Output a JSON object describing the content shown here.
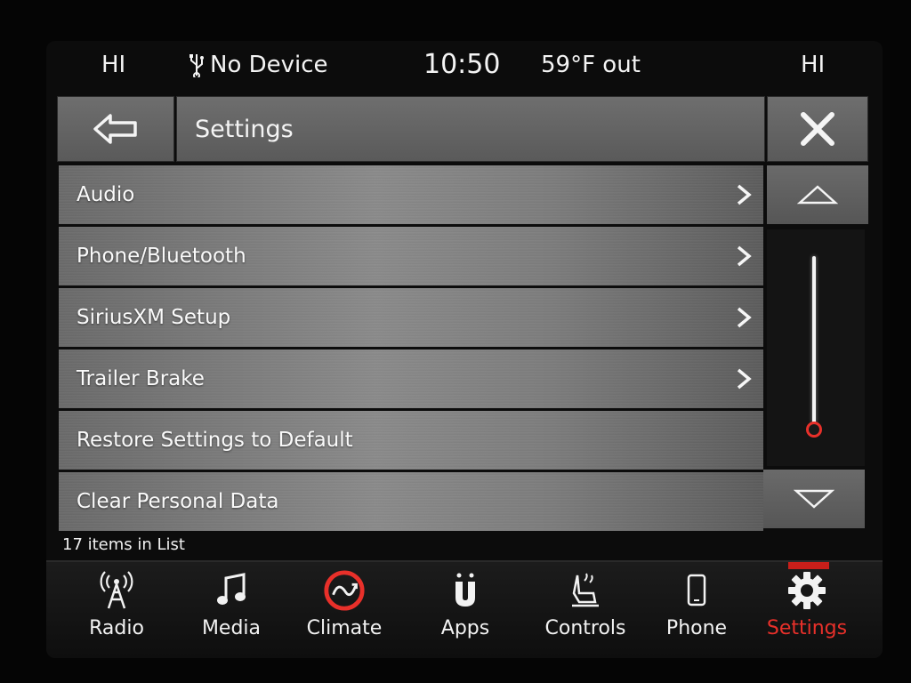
{
  "status": {
    "left_temp": "HI",
    "device": "No Device",
    "time": "10:50",
    "outside_temp": "59°F out",
    "right_temp": "HI"
  },
  "header": {
    "title": "Settings"
  },
  "settings_list": {
    "items": [
      {
        "label": "Audio",
        "has_submenu": true
      },
      {
        "label": "Phone/Bluetooth",
        "has_submenu": true
      },
      {
        "label": "SiriusXM Setup",
        "has_submenu": true
      },
      {
        "label": "Trailer Brake",
        "has_submenu": true
      },
      {
        "label": "Restore Settings to Default",
        "has_submenu": false
      },
      {
        "label": "Clear Personal Data",
        "has_submenu": false
      }
    ],
    "count_text": "17 items in List",
    "scroll_position": 0.0
  },
  "nav": {
    "items": [
      {
        "label": "Radio",
        "icon": "radio-tower-icon"
      },
      {
        "label": "Media",
        "icon": "music-note-icon"
      },
      {
        "label": "Climate",
        "icon": "climate-icon"
      },
      {
        "label": "Apps",
        "icon": "apps-icon"
      },
      {
        "label": "Controls",
        "icon": "seat-controls-icon"
      },
      {
        "label": "Phone",
        "icon": "phone-icon"
      },
      {
        "label": "Settings",
        "icon": "gear-icon"
      }
    ],
    "active": "Settings"
  },
  "colors": {
    "accent": "#e8302a",
    "text": "#f2f2f2",
    "row_bg": "#7a7a7a"
  }
}
